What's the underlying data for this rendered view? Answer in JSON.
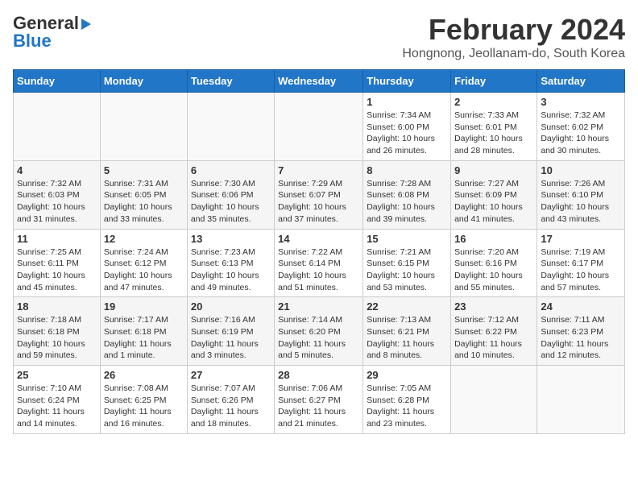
{
  "logo": {
    "line1": "General",
    "line2": "Blue",
    "arrow": "▶"
  },
  "title": "February 2024",
  "subtitle": "Hongnong, Jeollanam-do, South Korea",
  "days_of_week": [
    "Sunday",
    "Monday",
    "Tuesday",
    "Wednesday",
    "Thursday",
    "Friday",
    "Saturday"
  ],
  "weeks": [
    [
      {
        "day": "",
        "info": ""
      },
      {
        "day": "",
        "info": ""
      },
      {
        "day": "",
        "info": ""
      },
      {
        "day": "",
        "info": ""
      },
      {
        "day": "1",
        "info": "Sunrise: 7:34 AM\nSunset: 6:00 PM\nDaylight: 10 hours\nand 26 minutes."
      },
      {
        "day": "2",
        "info": "Sunrise: 7:33 AM\nSunset: 6:01 PM\nDaylight: 10 hours\nand 28 minutes."
      },
      {
        "day": "3",
        "info": "Sunrise: 7:32 AM\nSunset: 6:02 PM\nDaylight: 10 hours\nand 30 minutes."
      }
    ],
    [
      {
        "day": "4",
        "info": "Sunrise: 7:32 AM\nSunset: 6:03 PM\nDaylight: 10 hours\nand 31 minutes."
      },
      {
        "day": "5",
        "info": "Sunrise: 7:31 AM\nSunset: 6:05 PM\nDaylight: 10 hours\nand 33 minutes."
      },
      {
        "day": "6",
        "info": "Sunrise: 7:30 AM\nSunset: 6:06 PM\nDaylight: 10 hours\nand 35 minutes."
      },
      {
        "day": "7",
        "info": "Sunrise: 7:29 AM\nSunset: 6:07 PM\nDaylight: 10 hours\nand 37 minutes."
      },
      {
        "day": "8",
        "info": "Sunrise: 7:28 AM\nSunset: 6:08 PM\nDaylight: 10 hours\nand 39 minutes."
      },
      {
        "day": "9",
        "info": "Sunrise: 7:27 AM\nSunset: 6:09 PM\nDaylight: 10 hours\nand 41 minutes."
      },
      {
        "day": "10",
        "info": "Sunrise: 7:26 AM\nSunset: 6:10 PM\nDaylight: 10 hours\nand 43 minutes."
      }
    ],
    [
      {
        "day": "11",
        "info": "Sunrise: 7:25 AM\nSunset: 6:11 PM\nDaylight: 10 hours\nand 45 minutes."
      },
      {
        "day": "12",
        "info": "Sunrise: 7:24 AM\nSunset: 6:12 PM\nDaylight: 10 hours\nand 47 minutes."
      },
      {
        "day": "13",
        "info": "Sunrise: 7:23 AM\nSunset: 6:13 PM\nDaylight: 10 hours\nand 49 minutes."
      },
      {
        "day": "14",
        "info": "Sunrise: 7:22 AM\nSunset: 6:14 PM\nDaylight: 10 hours\nand 51 minutes."
      },
      {
        "day": "15",
        "info": "Sunrise: 7:21 AM\nSunset: 6:15 PM\nDaylight: 10 hours\nand 53 minutes."
      },
      {
        "day": "16",
        "info": "Sunrise: 7:20 AM\nSunset: 6:16 PM\nDaylight: 10 hours\nand 55 minutes."
      },
      {
        "day": "17",
        "info": "Sunrise: 7:19 AM\nSunset: 6:17 PM\nDaylight: 10 hours\nand 57 minutes."
      }
    ],
    [
      {
        "day": "18",
        "info": "Sunrise: 7:18 AM\nSunset: 6:18 PM\nDaylight: 10 hours\nand 59 minutes."
      },
      {
        "day": "19",
        "info": "Sunrise: 7:17 AM\nSunset: 6:18 PM\nDaylight: 11 hours\nand 1 minute."
      },
      {
        "day": "20",
        "info": "Sunrise: 7:16 AM\nSunset: 6:19 PM\nDaylight: 11 hours\nand 3 minutes."
      },
      {
        "day": "21",
        "info": "Sunrise: 7:14 AM\nSunset: 6:20 PM\nDaylight: 11 hours\nand 5 minutes."
      },
      {
        "day": "22",
        "info": "Sunrise: 7:13 AM\nSunset: 6:21 PM\nDaylight: 11 hours\nand 8 minutes."
      },
      {
        "day": "23",
        "info": "Sunrise: 7:12 AM\nSunset: 6:22 PM\nDaylight: 11 hours\nand 10 minutes."
      },
      {
        "day": "24",
        "info": "Sunrise: 7:11 AM\nSunset: 6:23 PM\nDaylight: 11 hours\nand 12 minutes."
      }
    ],
    [
      {
        "day": "25",
        "info": "Sunrise: 7:10 AM\nSunset: 6:24 PM\nDaylight: 11 hours\nand 14 minutes."
      },
      {
        "day": "26",
        "info": "Sunrise: 7:08 AM\nSunset: 6:25 PM\nDaylight: 11 hours\nand 16 minutes."
      },
      {
        "day": "27",
        "info": "Sunrise: 7:07 AM\nSunset: 6:26 PM\nDaylight: 11 hours\nand 18 minutes."
      },
      {
        "day": "28",
        "info": "Sunrise: 7:06 AM\nSunset: 6:27 PM\nDaylight: 11 hours\nand 21 minutes."
      },
      {
        "day": "29",
        "info": "Sunrise: 7:05 AM\nSunset: 6:28 PM\nDaylight: 11 hours\nand 23 minutes."
      },
      {
        "day": "",
        "info": ""
      },
      {
        "day": "",
        "info": ""
      }
    ]
  ]
}
